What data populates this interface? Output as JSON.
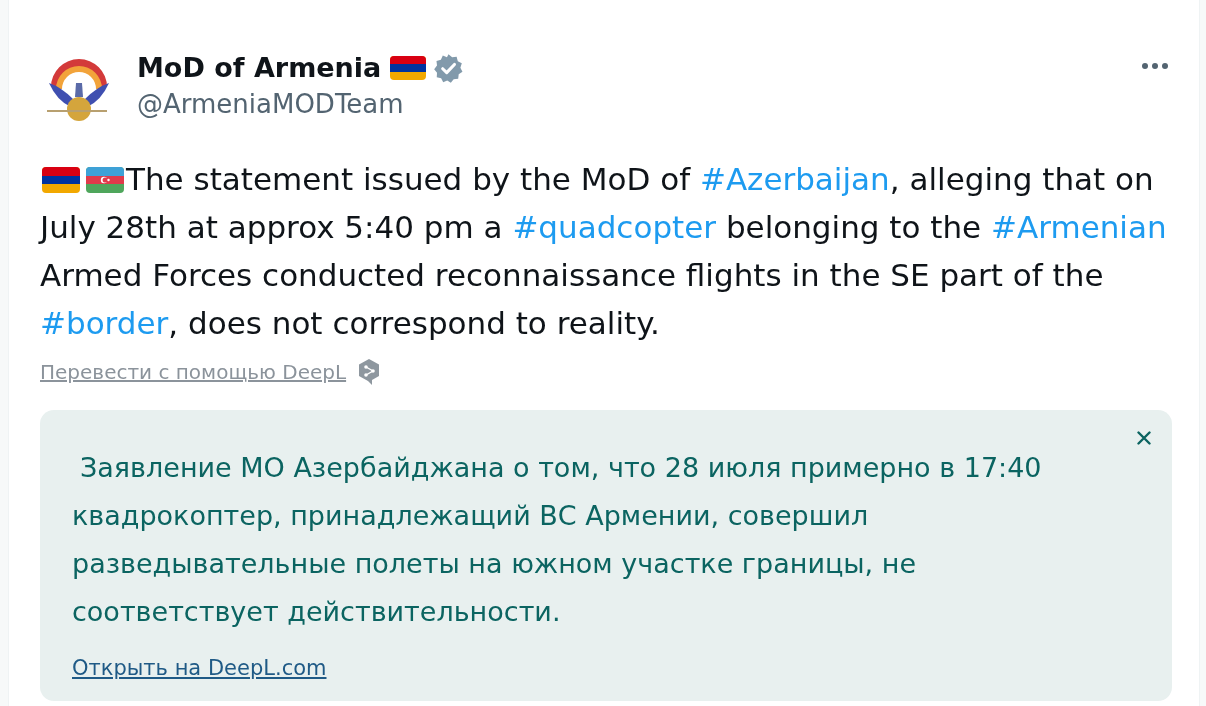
{
  "author": {
    "name": "MoD of Armenia",
    "handle": "@ArmeniaMODTeam",
    "verified": true
  },
  "tweet": {
    "segments": [
      {
        "kind": "text",
        "text": "The statement issued by the MoD of "
      },
      {
        "kind": "hashtag",
        "text": "#Azerbaijan"
      },
      {
        "kind": "text",
        "text": ", alleging that on July 28th at approx 5:40 pm a "
      },
      {
        "kind": "hashtag",
        "text": "#quadcopter"
      },
      {
        "kind": "text",
        "text": " belonging to the "
      },
      {
        "kind": "hashtag",
        "text": "#Armenian"
      },
      {
        "kind": "text",
        "text": " Armed Forces conducted reconnaissance flights in the SE part of the "
      },
      {
        "kind": "hashtag",
        "text": "#border"
      },
      {
        "kind": "text",
        "text": ", does not correspond to reality."
      }
    ]
  },
  "translate_link": {
    "label": "Перевести с помощью DeepL"
  },
  "translation": {
    "text": "Заявление МО Азербайджана о том, что 28 июля примерно в 17:40 квадрокоптер, принадлежащий ВС Армении, совершил разведывательные полеты на южном участке границы, не соответствует действительности.",
    "link": "Открыть на DeepL.com"
  }
}
